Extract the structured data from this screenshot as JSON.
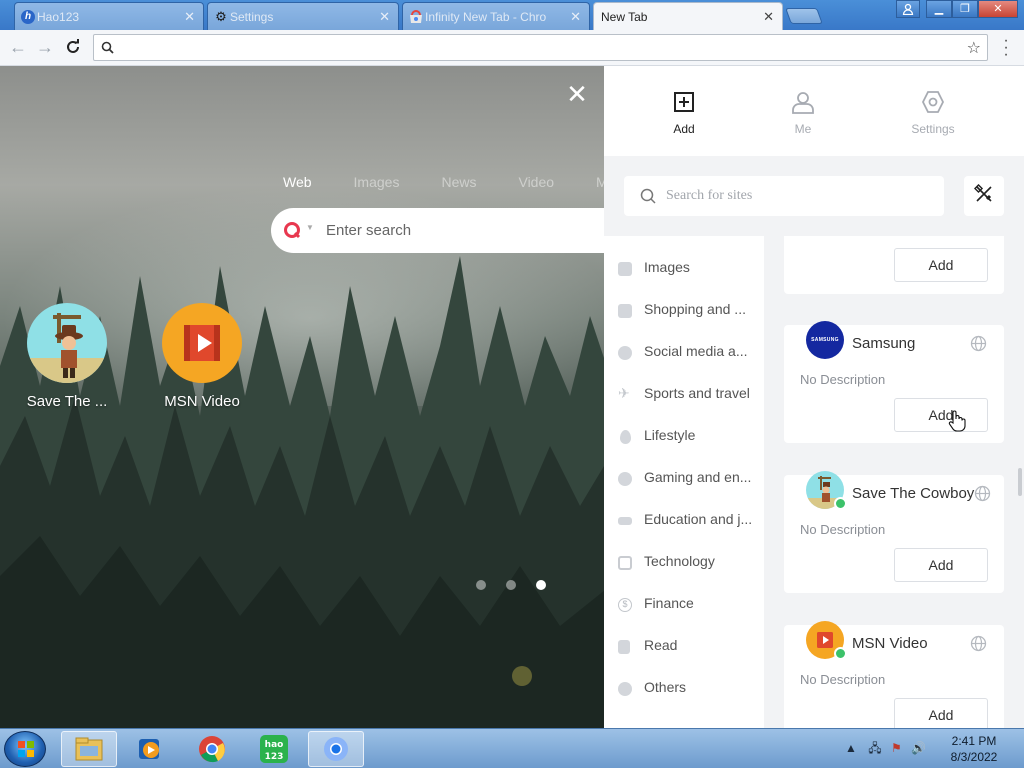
{
  "browser": {
    "tabs": [
      {
        "label": "Hao123",
        "icon": "hao123-icon"
      },
      {
        "label": "Settings",
        "icon": "gear-icon"
      },
      {
        "label": "Infinity New Tab - Chro",
        "icon": "chrome-webstore-icon"
      },
      {
        "label": "New Tab",
        "icon": null
      }
    ],
    "active_tab": "New Tab",
    "address": {
      "value": "",
      "placeholder": ""
    }
  },
  "newtab": {
    "search_engines": [
      "Web",
      "Images",
      "News",
      "Video",
      "M"
    ],
    "active_engine": "Web",
    "search_placeholder": "Enter search",
    "shortcuts": [
      {
        "label": "Save The ...",
        "icon": "cowboy-icon"
      },
      {
        "label": "MSN Video",
        "icon": "msn-video-icon"
      }
    ],
    "pages": 3,
    "active_page": 3
  },
  "panel": {
    "tabs": [
      {
        "label": "Add",
        "icon": "add-square-icon"
      },
      {
        "label": "Me",
        "icon": "user-icon"
      },
      {
        "label": "Settings",
        "icon": "hexagon-gear-icon"
      }
    ],
    "active_tab": "Add",
    "search_placeholder": "Search for sites",
    "categories": [
      {
        "label": "Images",
        "icon": "image-icon"
      },
      {
        "label": "Shopping and ...",
        "icon": "shopping-icon"
      },
      {
        "label": "Social media a...",
        "icon": "chat-icon"
      },
      {
        "label": "Sports and travel",
        "icon": "plane-icon"
      },
      {
        "label": "Lifestyle",
        "icon": "drop-icon"
      },
      {
        "label": "Gaming and en...",
        "icon": "gamepad-icon"
      },
      {
        "label": "Education and j...",
        "icon": "graduation-icon"
      },
      {
        "label": "Technology",
        "icon": "circuit-icon"
      },
      {
        "label": "Finance",
        "icon": "dollar-icon"
      },
      {
        "label": "Read",
        "icon": "book-icon"
      },
      {
        "label": "Others",
        "icon": "dots-icon"
      }
    ],
    "add_label": "Add",
    "sites": [
      {
        "name": "Samsung",
        "desc": "No Description",
        "logo": "samsung-logo",
        "logo_text": "SAMSUNG",
        "added": false
      },
      {
        "name": "Save The Cowboy",
        "desc": "No Description",
        "logo": "cowboy-icon",
        "added": true
      },
      {
        "name": "MSN Video",
        "desc": "No Description",
        "logo": "msn-video-icon",
        "added": true
      }
    ]
  },
  "taskbar": {
    "items": [
      "explorer-icon",
      "media-player-icon",
      "chrome-icon",
      "hao123-icon",
      "chromium-icon"
    ],
    "clock_time": "2:41 PM",
    "clock_date": "8/3/2022"
  },
  "colors": {
    "titlebar_blue": "#3978c8",
    "panel_bg": "#f2f3f5",
    "check_green": "#3cc26a",
    "samsung_blue": "#1428a0",
    "msn_orange": "#f5a623"
  }
}
